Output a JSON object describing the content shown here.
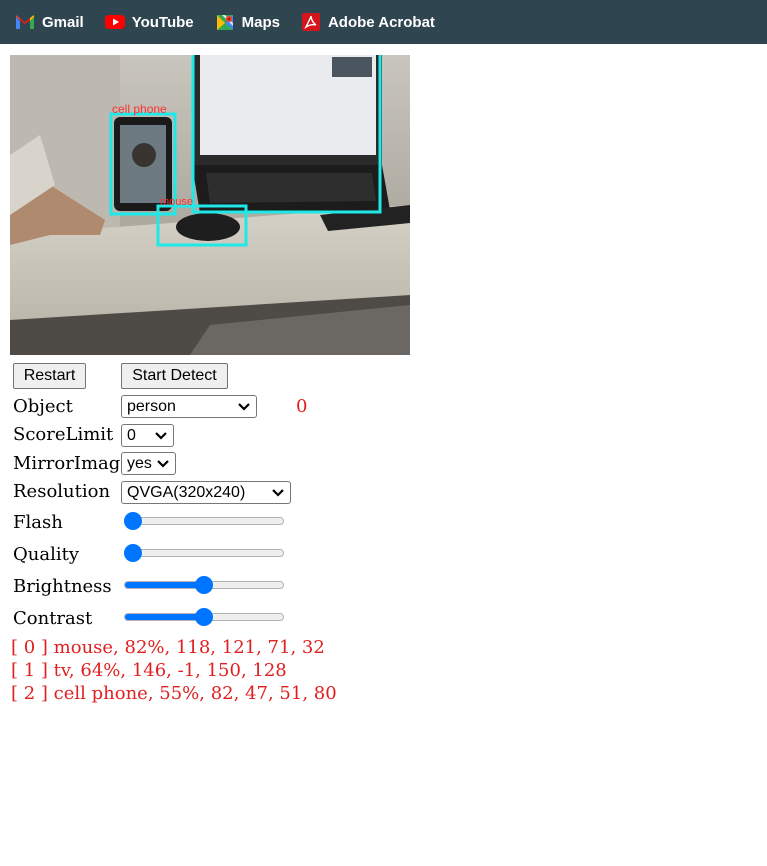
{
  "bookmarks": [
    {
      "label": "Gmail",
      "icon": "gmail-icon"
    },
    {
      "label": "YouTube",
      "icon": "youtube-icon"
    },
    {
      "label": "Maps",
      "icon": "maps-icon"
    },
    {
      "label": "Adobe Acrobat",
      "icon": "adobe-acrobat-icon"
    }
  ],
  "camera": {
    "detection_labels": [
      "cell phone",
      "mouse"
    ],
    "box_color": "#1ee8e8",
    "label_color": "#ff3030"
  },
  "buttons": {
    "restart": "Restart",
    "start_detect": "Start Detect"
  },
  "controls": {
    "object": {
      "label": "Object",
      "value": "person"
    },
    "object_count": "0",
    "score_limit": {
      "label": "ScoreLimit",
      "value": "0"
    },
    "mirror_image": {
      "label": "MirrorImage",
      "value": "yes"
    },
    "resolution": {
      "label": "Resolution",
      "value": "QVGA(320x240)"
    },
    "flash": {
      "label": "Flash",
      "level": 0
    },
    "quality": {
      "label": "Quality",
      "level": 0
    },
    "brightness": {
      "label": "Brightness",
      "level": 0.5
    },
    "contrast": {
      "label": "Contrast",
      "level": 0.5
    }
  },
  "results": [
    "[ 0 ] mouse, 82%, 118, 121, 71, 32",
    "[ 1 ] tv, 64%, 146, -1, 150, 128",
    "[ 2 ] cell phone, 55%, 82, 47, 51, 80"
  ],
  "colors": {
    "toolbar_bg": "#2f4550",
    "accent": "#0075ff",
    "result_text": "#e02020"
  }
}
